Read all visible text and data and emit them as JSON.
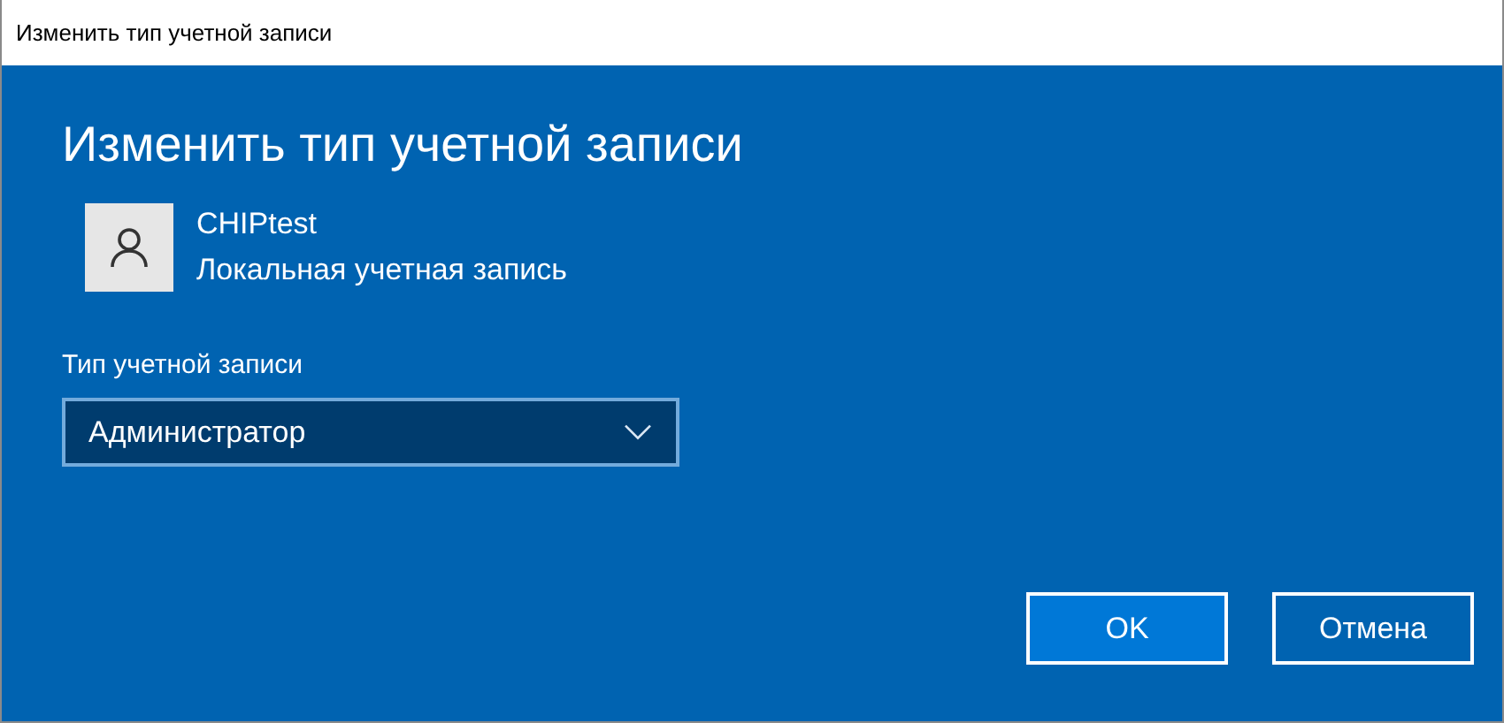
{
  "window": {
    "title": "Изменить тип учетной записи"
  },
  "heading": "Изменить тип учетной записи",
  "account": {
    "name": "CHIPtest",
    "type": "Локальная учетная запись"
  },
  "account_type": {
    "label": "Тип учетной записи",
    "value": "Администратор"
  },
  "buttons": [
    {
      "label": "OK",
      "kind": "primary"
    },
    {
      "label": "Отмена",
      "kind": "secondary"
    }
  ]
}
